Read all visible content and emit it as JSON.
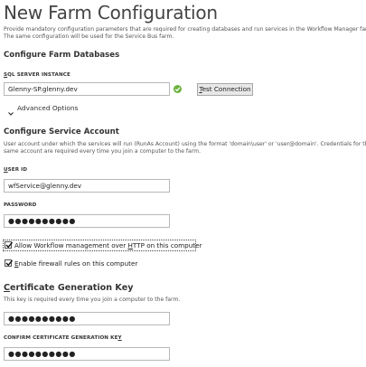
{
  "page": {
    "title": "New Farm Configuration",
    "description_line1": "Provide mandatory configuration parameters that are required for creating databases and run services in the Workflow Manager farm.",
    "description_line2": "The same configuration will be used for the Service Bus farm."
  },
  "farm_db": {
    "heading": "Configure Farm Databases",
    "sql_label": "SQL SERVER INSTANCE",
    "sql_value": "Glenny-SP.glenny.dev",
    "test_button": "Test Connection",
    "status_icon": "check-circle-icon",
    "advanced_label": "Advanced Options"
  },
  "service_account": {
    "heading": "Configure Service Account",
    "desc_line1": "User account under which the services will run (RunAs Account) using the format 'domain\\user' or 'user@domain'. Credentials for the",
    "desc_line2": "same account are required every time you join a computer to the farm.",
    "user_label": "USER ID",
    "user_value": "wfService@glenny.dev",
    "password_label": "PASSWORD",
    "password_value": "●●●●●●●●●●",
    "allow_http_label": "Allow Workflow management over HTTP on this computer",
    "allow_http_checked": true,
    "firewall_label": "Enable firewall rules on this computer",
    "firewall_checked": true
  },
  "cert_key": {
    "heading": "Certificate Generation Key",
    "desc": "This key is required every time you join a computer to the farm.",
    "key_value": "●●●●●●●●●●",
    "confirm_label": "CONFIRM CERTIFICATE GENERATION KEY",
    "confirm_value": "●●●●●●●●●●"
  },
  "colors": {
    "success": "#6cb33f",
    "title": "#444444"
  }
}
